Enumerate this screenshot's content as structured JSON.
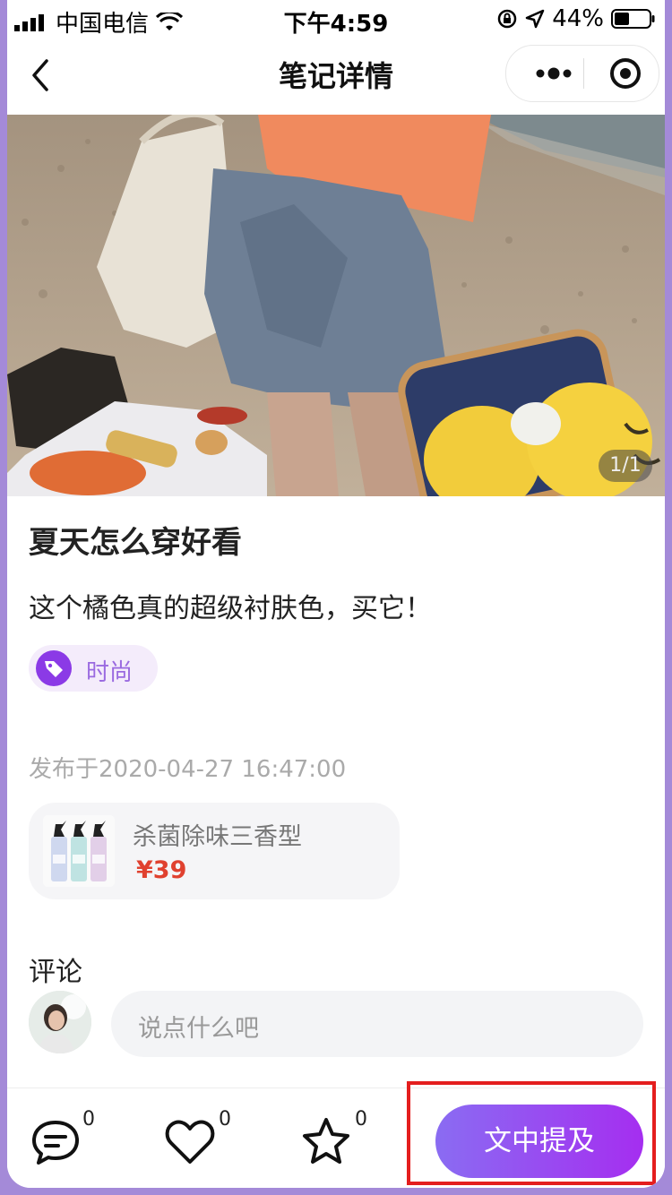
{
  "status_bar": {
    "carrier": "中国电信",
    "time": "下午4:59",
    "battery": "44%"
  },
  "nav": {
    "title": "笔记详情"
  },
  "hero": {
    "counter": "1/1"
  },
  "note": {
    "title": "夏天怎么穿好看",
    "description": "这个橘色真的超级衬肤色，买它！",
    "tag": "时尚",
    "published": "发布于2020-04-27 16:47:00"
  },
  "product": {
    "name": "杀菌除味三香型",
    "price": "¥39"
  },
  "comments": {
    "heading": "评论",
    "placeholder": "说点什么吧"
  },
  "bottom_bar": {
    "comment_count": "0",
    "like_count": "0",
    "favorite_count": "0",
    "cta_label": "文中提及"
  },
  "colors": {
    "accent": "#a52ef0",
    "price": "#e0412f",
    "highlight_box": "#e41e1e",
    "frame": "#a48ad8"
  }
}
